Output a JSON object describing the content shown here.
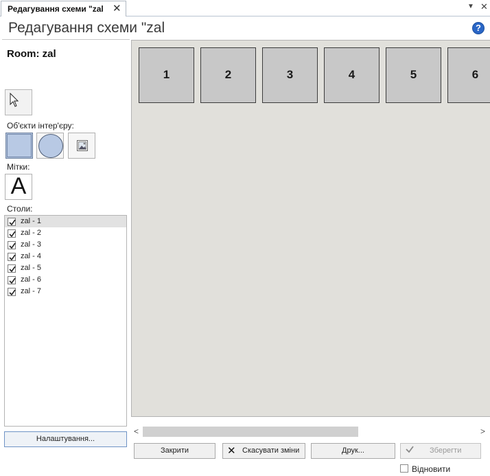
{
  "tab": {
    "title": "Редагування схеми \"zal",
    "close_glyph": "✕"
  },
  "window_controls": {
    "menu_glyph": "▼",
    "close_glyph": "✕"
  },
  "page": {
    "title": "Редагування схеми \"zal",
    "help_glyph": "?"
  },
  "room": {
    "label": "Room: zal"
  },
  "tools": {
    "pointer_icon": "cursor-arrow-icon",
    "interior_label": "Об'єкти інтер'єру:",
    "interior_items": [
      "rectangle-icon",
      "circle-icon",
      "image-icon"
    ],
    "marks_label": "Мітки:",
    "text_glyph": "A",
    "tables_label": "Столи:"
  },
  "tables_list": [
    {
      "label": "zal - 1",
      "checked": true,
      "selected": true
    },
    {
      "label": "zal - 2",
      "checked": true,
      "selected": false
    },
    {
      "label": "zal - 3",
      "checked": true,
      "selected": false
    },
    {
      "label": "zal - 4",
      "checked": true,
      "selected": false
    },
    {
      "label": "zal - 5",
      "checked": true,
      "selected": false
    },
    {
      "label": "zal - 6",
      "checked": true,
      "selected": false
    },
    {
      "label": "zal - 7",
      "checked": true,
      "selected": false
    }
  ],
  "settings_button": "Налаштування...",
  "canvas": {
    "tables": [
      "1",
      "2",
      "3",
      "4",
      "5",
      "6"
    ]
  },
  "scrollbar": {
    "left_glyph": "<",
    "right_glyph": ">"
  },
  "buttons": {
    "close": "Закрити",
    "cancel": "Скасувати зміни",
    "cancel_glyph": "✕",
    "print": "Друк...",
    "save": "Зберегти"
  },
  "restore": {
    "label": "Відновити",
    "checked": false
  },
  "colors": {
    "canvas_bg": "#e1e0db",
    "table_fill": "#c8c8c8",
    "shape_fill": "#b8c9e4",
    "help_blue": "#2a66c6"
  }
}
